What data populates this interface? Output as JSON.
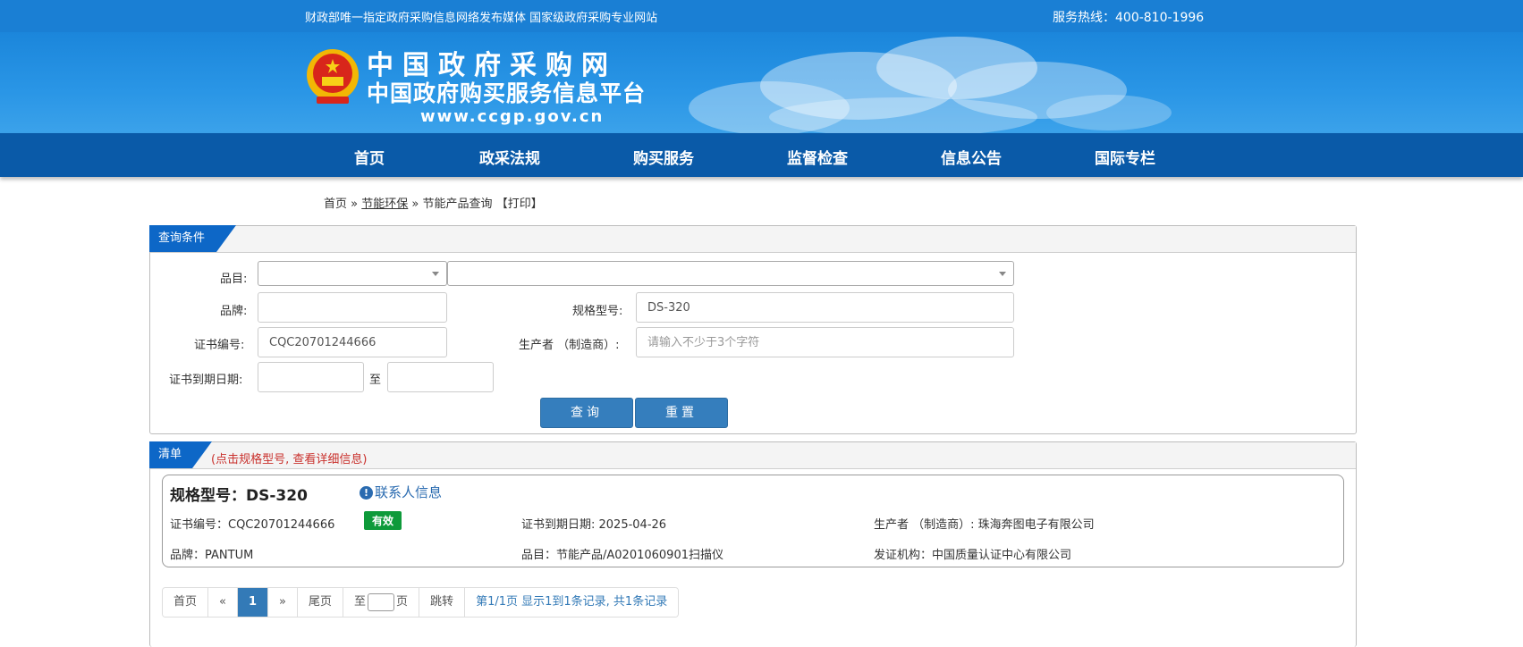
{
  "topbar": {
    "slogan": "财政部唯一指定政府采购信息网络发布媒体 国家级政府采购专业网站",
    "hotline": "服务热线：400-810-1996"
  },
  "header": {
    "logo_line1": "中国政府采购网",
    "logo_line2": "中国政府购买服务信息平台",
    "logo_url": "www.ccgp.gov.cn"
  },
  "nav": {
    "items": [
      {
        "label": "首页"
      },
      {
        "label": "政采法规"
      },
      {
        "label": "购买服务"
      },
      {
        "label": "监督检查"
      },
      {
        "label": "信息公告"
      },
      {
        "label": "国际专栏"
      }
    ]
  },
  "breadcrumb": {
    "home": "首页",
    "sep": "»",
    "section": "节能环保",
    "page": "节能产品查询",
    "print": "【打印】"
  },
  "query": {
    "title": "查询条件",
    "category_label": "品目:",
    "brand_label": "品牌:",
    "model_label": "规格型号:",
    "model_value": "DS-320",
    "cert_label": "证书编号:",
    "cert_value": "CQC20701244666",
    "maker_label": "生产者 （制造商）:",
    "maker_placeholder": "请输入不少于3个字符",
    "expiry_label": "证书到期日期:",
    "to_label": "至",
    "search_button": "查询",
    "reset_button": "重置"
  },
  "list": {
    "title": "清单",
    "hint": "(点击规格型号, 查看详细信息)",
    "items": [
      {
        "model_title": "规格型号：DS-320",
        "contact_icon": "info-circle-icon",
        "contact_label": "联系人信息",
        "cert_no": "证书编号：CQC20701244666",
        "status": "有效",
        "expiry": "证书到期日期: 2025-04-26",
        "maker": "生产者 （制造商）: 珠海奔图电子有限公司",
        "brand": "品牌：PANTUM",
        "category": "品目：节能产品/A0201060901扫描仪",
        "issuer": "发证机构：中国质量认证中心有限公司"
      }
    ]
  },
  "pager": {
    "first": "首页",
    "prev": "«",
    "current": "1",
    "next": "»",
    "last": "尾页",
    "goto_prefix": "至",
    "goto_suffix": "页",
    "jump": "跳转",
    "info": "第1/1页  显示1到1条记录, 共1条记录"
  },
  "colors": {
    "topbar": "#1a7fd4",
    "nav": "#0a5aa8",
    "tab": "#0d67c7",
    "button": "#357ebd",
    "valid_badge": "#0e9a3a",
    "hint_red": "#c9302c"
  }
}
